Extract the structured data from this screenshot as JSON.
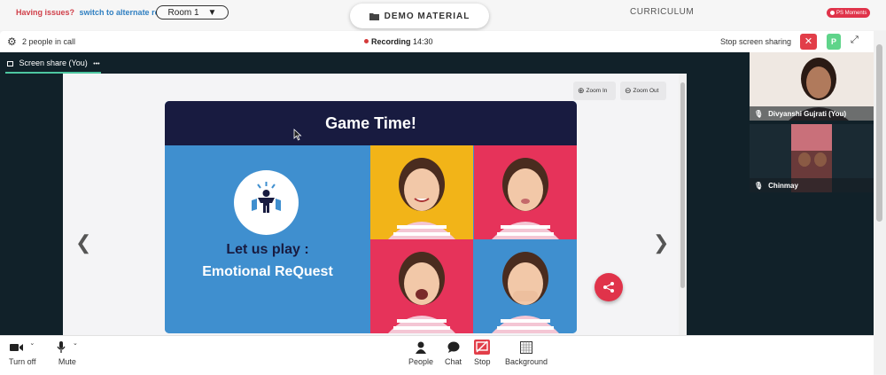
{
  "topbar": {
    "issues_text": "Having issues?",
    "alternate_link": "switch to alternate room",
    "room_value": "Room 1",
    "room_caret": "▼",
    "demo_material": "DEMO MATERIAL",
    "curriculum": "CURRICULUM",
    "ps_moments": "PS Moments"
  },
  "callbar": {
    "people_in_call": "2 people in call",
    "recording_label": "Recording",
    "recording_time": "14:30",
    "stop_sharing": "Stop screen sharing",
    "close_symbol": "✕",
    "participant_initial": "P"
  },
  "stage": {
    "tab_label": "Screen share (You)",
    "tab_menu": "•••",
    "zoom_in": "Zoom In",
    "zoom_out": "Zoom Out",
    "slide": {
      "header": "Game Time!",
      "title": "Let us play :",
      "subtitle": "Emotional ReQuest"
    },
    "prev_arrow": "❮",
    "next_arrow": "❯"
  },
  "participants": [
    {
      "name": "Divyanshi Gujrati (You)"
    },
    {
      "name": "Chinmay"
    }
  ],
  "controls": {
    "turn_off": "Turn off",
    "mute": "Mute",
    "people": "People",
    "chat": "Chat",
    "stop": "Stop",
    "background": "Background"
  },
  "colors": {
    "accent_red": "#e0334a",
    "slide_navy": "#181b40",
    "slide_blue": "#3f8fcf",
    "quad_yellow": "#f2b418",
    "quad_pink": "#e6335a"
  }
}
